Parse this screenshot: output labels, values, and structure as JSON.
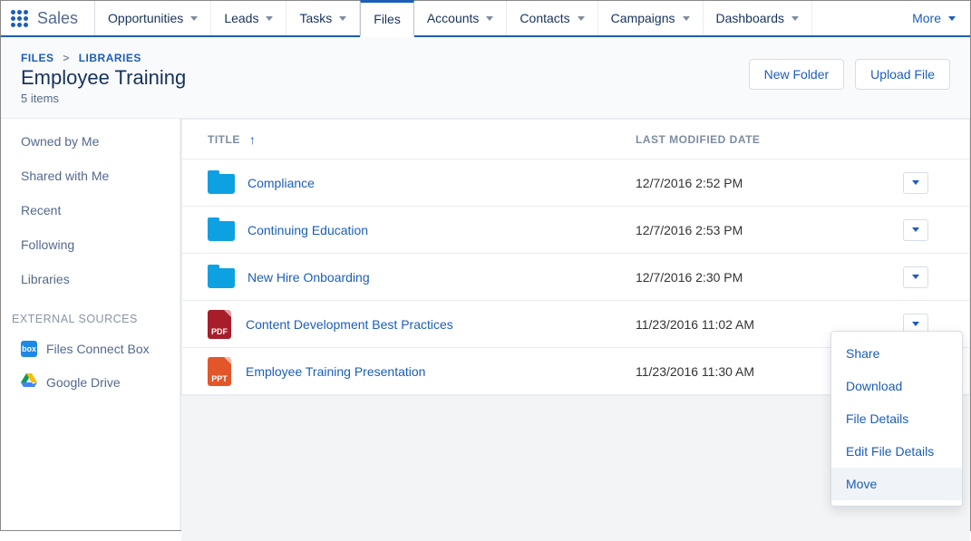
{
  "app_name": "Sales",
  "nav": {
    "tabs": [
      {
        "label": "Opportunities",
        "chevron": true
      },
      {
        "label": "Leads",
        "chevron": true
      },
      {
        "label": "Tasks",
        "chevron": true
      },
      {
        "label": "Files",
        "chevron": false,
        "active": true
      },
      {
        "label": "Accounts",
        "chevron": true
      },
      {
        "label": "Contacts",
        "chevron": true
      },
      {
        "label": "Campaigns",
        "chevron": true
      },
      {
        "label": "Dashboards",
        "chevron": true
      }
    ],
    "more_label": "More"
  },
  "header": {
    "breadcrumb": {
      "root": "FILES",
      "current": "LIBRARIES"
    },
    "title": "Employee Training",
    "subtitle": "5 items",
    "actions": {
      "new_folder": "New Folder",
      "upload_file": "Upload File"
    }
  },
  "sidebar": {
    "items": [
      {
        "label": "Owned by Me"
      },
      {
        "label": "Shared with Me"
      },
      {
        "label": "Recent"
      },
      {
        "label": "Following"
      },
      {
        "label": "Libraries"
      }
    ],
    "external_header": "EXTERNAL SOURCES",
    "external": [
      {
        "label": "Files Connect Box",
        "icon": "box"
      },
      {
        "label": "Google Drive",
        "icon": "gdrive"
      }
    ]
  },
  "list": {
    "columns": {
      "title": "TITLE",
      "date": "LAST MODIFIED DATE"
    },
    "rows": [
      {
        "type": "folder",
        "title": "Compliance",
        "date": "12/7/2016 2:52 PM"
      },
      {
        "type": "folder",
        "title": "Continuing Education",
        "date": "12/7/2016 2:53 PM"
      },
      {
        "type": "folder",
        "title": "New Hire Onboarding",
        "date": "12/7/2016 2:30 PM"
      },
      {
        "type": "pdf",
        "title": "Content Development Best Practices",
        "date": "11/23/2016 11:02 AM"
      },
      {
        "type": "ppt",
        "title": "Employee Training Presentation",
        "date": "11/23/2016 11:30 AM"
      }
    ]
  },
  "dropdown": {
    "items": [
      {
        "label": "Share"
      },
      {
        "label": "Download"
      },
      {
        "label": "File Details"
      },
      {
        "label": "Edit File Details"
      },
      {
        "label": "Move",
        "highlight": true
      }
    ]
  }
}
